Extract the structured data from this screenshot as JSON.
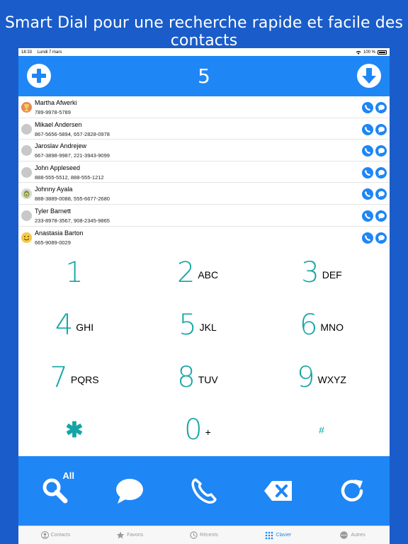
{
  "headline": "Smart Dial pour une recherche rapide et facile des contacts",
  "status": {
    "time": "18:33",
    "date": "Lundi 7 mars",
    "battery": "100 %"
  },
  "topbar": {
    "number": "5"
  },
  "contacts": [
    {
      "name": "Martha Afwerki",
      "phones": "789-9978-5789",
      "avatar": "photo-trophy"
    },
    {
      "name": "Mikael Andersen",
      "phones": "867-5656-5894, 657-2828-0978",
      "avatar": "placeholder"
    },
    {
      "name": "Jaroslav Andrejew",
      "phones": "667-3898-9987, 221-3943-9099",
      "avatar": "placeholder"
    },
    {
      "name": "John Appleseed",
      "phones": "888-555-5512, 888-555-1212",
      "avatar": "placeholder"
    },
    {
      "name": "Johnny Ayala",
      "phones": "888-3889-0088, 555-6677-2680",
      "avatar": "photo-avocado"
    },
    {
      "name": "Tyler Barnett",
      "phones": "233-8978-3567, 908-2345-9865",
      "avatar": "placeholder"
    },
    {
      "name": "Anastasia Barton",
      "phones": "665-9089-0029",
      "avatar": "photo-smiley"
    }
  ],
  "keypad": [
    {
      "digit": "1",
      "letters": ""
    },
    {
      "digit": "2",
      "letters": "ABC"
    },
    {
      "digit": "3",
      "letters": "DEF"
    },
    {
      "digit": "4",
      "letters": "GHI"
    },
    {
      "digit": "5",
      "letters": "JKL"
    },
    {
      "digit": "6",
      "letters": "MNO"
    },
    {
      "digit": "7",
      "letters": "PQRS"
    },
    {
      "digit": "8",
      "letters": "TUV"
    },
    {
      "digit": "9",
      "letters": "WXYZ"
    },
    {
      "digit": "✱",
      "letters": ""
    },
    {
      "digit": "0",
      "letters": "+"
    },
    {
      "digit": "#",
      "letters": ""
    }
  ],
  "actions": {
    "search_all_label": "All"
  },
  "tabs": [
    {
      "label": "Contacts",
      "icon": "person-icon"
    },
    {
      "label": "Favoris",
      "icon": "star-icon"
    },
    {
      "label": "Récents",
      "icon": "clock-icon"
    },
    {
      "label": "Clavier",
      "icon": "keypad-icon"
    },
    {
      "label": "Autres",
      "icon": "more-icon"
    }
  ],
  "colors": {
    "background": "#1a5cc9",
    "accent": "#1f86f5",
    "digit": "#13a5a5"
  }
}
